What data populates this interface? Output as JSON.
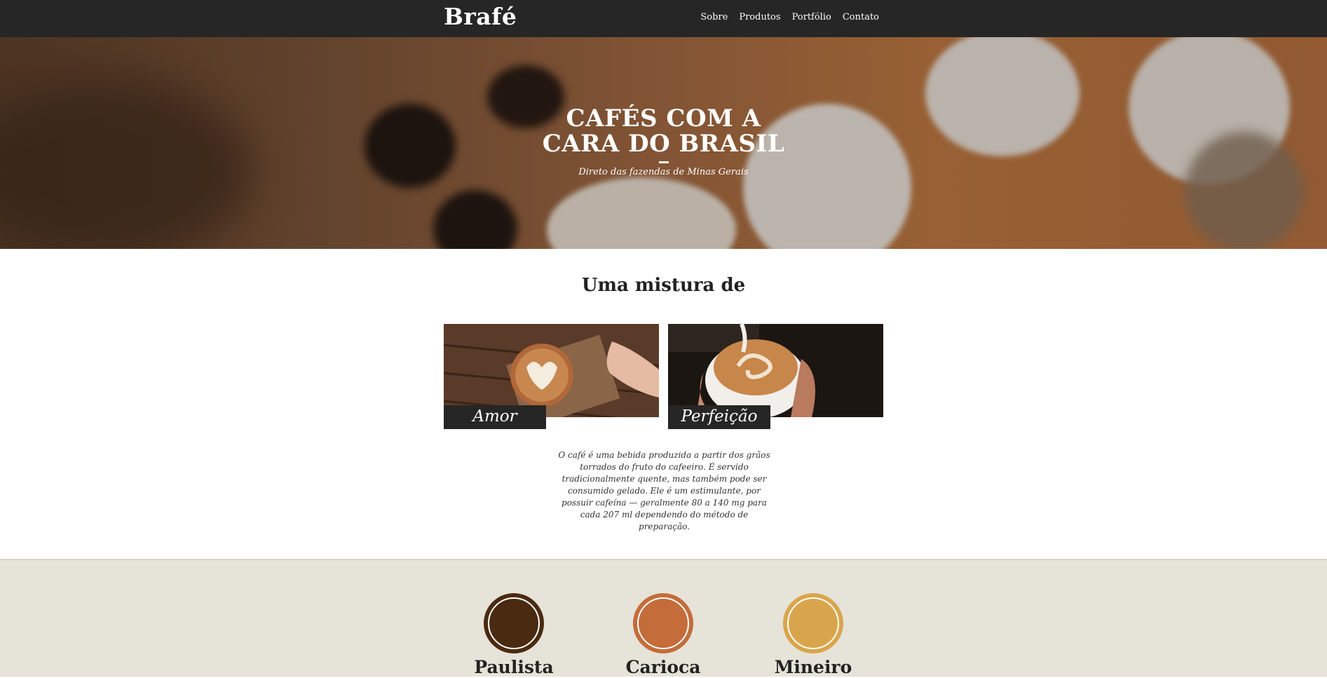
{
  "header": {
    "brand": "Brafé",
    "nav": [
      "Sobre",
      "Produtos",
      "Portfólio",
      "Contato"
    ]
  },
  "hero": {
    "title": "CAFÉS COM A CARA DO BRASIL",
    "subtitle": "Direto das fazendas de Minas Gerais"
  },
  "mix": {
    "title": "Uma mistura de",
    "cards": [
      {
        "caption": "Amor"
      },
      {
        "caption": "Perfeição"
      }
    ],
    "description": "O café é uma bebida produzida a partir dos grãos torrados do fruto do cafeeiro. É servido tradicionalmente quente, mas também pode ser consumido gelado. Ele é um estimulante, por possuir cafeína — geralmente 80 a 140 mg para cada 207 ml dependendo do método de preparação."
  },
  "flavors": [
    {
      "name": "Paulista",
      "color": "#4a2a10"
    },
    {
      "name": "Carioca",
      "color": "#c46c3a"
    },
    {
      "name": "Mineiro",
      "color": "#d9a54c"
    }
  ]
}
